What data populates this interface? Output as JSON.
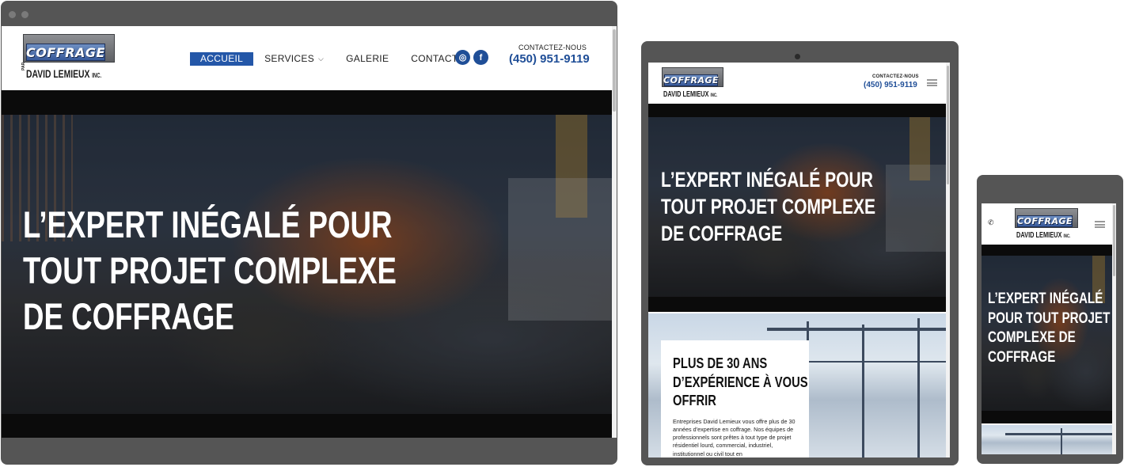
{
  "brand": {
    "logo_word": "COFFRAGE",
    "logo_by": "PAR",
    "logo_name": "DAVID LEMIEUX",
    "logo_suffix": "INC."
  },
  "desktop": {
    "nav": [
      {
        "label": "ACCUEIL",
        "active": true
      },
      {
        "label": "SERVICES",
        "has_dropdown": true
      },
      {
        "label": "GALERIE"
      },
      {
        "label": "CONTACT"
      }
    ],
    "social": [
      {
        "icon": "instagram-icon",
        "glyph": "◎"
      },
      {
        "icon": "facebook-icon",
        "glyph": "f"
      }
    ],
    "contact_label": "CONTACTEZ-NOUS",
    "phone": "(450) 951-9119",
    "hero_lines": [
      "L’EXPERT INÉGALÉ POUR",
      "TOUT PROJET COMPLEXE",
      "DE COFFRAGE"
    ]
  },
  "tablet": {
    "contact_label": "CONTACTEZ-NOUS",
    "phone": "(450) 951-9119",
    "hero_lines": [
      "L’EXPERT INÉGALÉ POUR",
      "TOUT PROJET COMPLEXE",
      "DE COFFRAGE"
    ],
    "card_title_lines": [
      "PLUS DE 30 ANS",
      "D’EXPÉRIENCE À VOUS",
      "OFFRIR"
    ],
    "card_text": "Entreprises David Lemieux vous offre plus de 30 années d’expertise en coffrage. Nos équipes de professionnels sont prêtes à tout type de projet résidentiel lourd, commercial, industriel, institutionnel ou civil tout en"
  },
  "phone": {
    "call_glyph": "✆",
    "hero_lines": [
      "L’EXPERT INÉGALÉ",
      "POUR TOUT PROJET",
      "COMPLEXE DE",
      "COFFRAGE"
    ]
  },
  "colors": {
    "brand_blue": "#1f4e97",
    "nav_active": "#2457a8",
    "frame": "#555555"
  }
}
